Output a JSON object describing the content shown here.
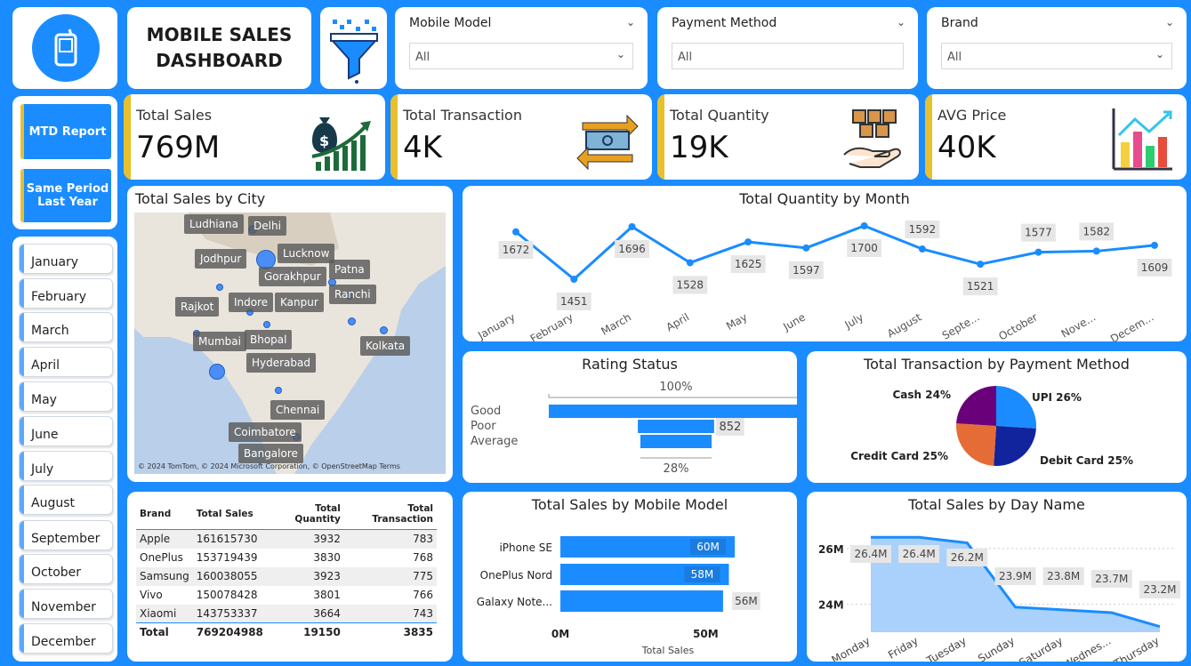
{
  "header": {
    "title_line1": "MOBILE SALES",
    "title_line2": "DASHBOARD"
  },
  "icons": {
    "logo": "mobile-phone-icon",
    "filter": "funnel-filter-icon"
  },
  "slicers": [
    {
      "label": "Mobile Model",
      "value": "All"
    },
    {
      "label": "Payment Method",
      "value": "All"
    },
    {
      "label": "Brand",
      "value": "All"
    }
  ],
  "kpis": [
    {
      "label": "Total Sales",
      "value": "769M",
      "icon": "money-growth-icon"
    },
    {
      "label": "Total Transaction",
      "value": "4K",
      "icon": "cash-exchange-icon"
    },
    {
      "label": "Total Quantity",
      "value": "19K",
      "icon": "boxes-hand-icon"
    },
    {
      "label": "AVG Price",
      "value": "40K",
      "icon": "bar-chart-icon"
    }
  ],
  "nav": {
    "mtd_label": "MTD Report",
    "same_period_line1": "Same Period",
    "same_period_line2": "Last Year"
  },
  "months": [
    "January",
    "February",
    "March",
    "April",
    "May",
    "June",
    "July",
    "August",
    "September",
    "October",
    "November",
    "December"
  ],
  "map": {
    "title": "Total Sales by City",
    "cities": [
      "Ludhiana",
      "Delhi",
      "Lucknow",
      "Jodhpur",
      "Patna",
      "Gorakhpur",
      "Ranchi",
      "Rajkot",
      "Indore",
      "Kanpur",
      "Bhopal",
      "Mumbai",
      "Kolkata",
      "Hyderabad",
      "Chennai",
      "Coimbatore",
      "Bangalore"
    ],
    "attribution": "© 2024 TomTom, © 2024 Microsoft Corporation, © OpenStreetMap  Terms"
  },
  "colors": {
    "background": "#1a8cff",
    "accent": "#1a8cff",
    "kpi_bar": "#e8c02e",
    "pie_upi": "#1a8cff",
    "pie_debit": "#12239e",
    "pie_credit": "#e66c37",
    "pie_cash": "#6b007b"
  },
  "table": {
    "headers": [
      "Brand",
      "Total Sales",
      "Total Quantity",
      "Total Transaction"
    ],
    "rows": [
      [
        "Apple",
        "161615730",
        "3932",
        "783"
      ],
      [
        "OnePlus",
        "153719439",
        "3830",
        "768"
      ],
      [
        "Samsung",
        "160038055",
        "3923",
        "775"
      ],
      [
        "Vivo",
        "150078428",
        "3801",
        "766"
      ],
      [
        "Xiaomi",
        "143753337",
        "3664",
        "743"
      ]
    ],
    "total": [
      "Total",
      "769204988",
      "19150",
      "3835"
    ]
  },
  "chart_data": [
    {
      "type": "line",
      "title": "Total Quantity by Month",
      "categories": [
        "January",
        "February",
        "March",
        "April",
        "May",
        "June",
        "July",
        "August",
        "Septe...",
        "October",
        "Nove...",
        "Decem..."
      ],
      "values": [
        1672,
        1451,
        1696,
        1528,
        1625,
        1597,
        1700,
        1592,
        1521,
        1577,
        1582,
        1609
      ],
      "value_labels": [
        "1672",
        "1451",
        "1696",
        "1528",
        "1625",
        "1597",
        "1700",
        "1592",
        "1521",
        "1577",
        "1582",
        "1609"
      ]
    },
    {
      "type": "bar",
      "title": "Rating Status",
      "categories": [
        "Good",
        "Poor",
        "Average"
      ],
      "values": [
        1.0,
        0.3,
        0.28
      ],
      "top_label": "100%",
      "bottom_label": "28%",
      "value_label": "852"
    },
    {
      "type": "pie",
      "title": "Total Transaction by Payment Method",
      "categories": [
        "UPI",
        "Debit Card",
        "Credit Card",
        "Cash"
      ],
      "values": [
        26,
        25,
        25,
        24
      ],
      "labels": [
        "UPI 26%",
        "Debit Card 25%",
        "Credit Card 25%",
        "Cash 24%"
      ]
    },
    {
      "type": "bar",
      "title": "Total Sales by Mobile Model",
      "categories": [
        "iPhone SE",
        "OnePlus Nord",
        "Galaxy Note..."
      ],
      "values": [
        60,
        58,
        56
      ],
      "value_labels": [
        "60M",
        "58M",
        "56M"
      ],
      "xlabel": "Total Sales",
      "ticks": [
        "0M",
        "50M"
      ],
      "xlim": [
        0,
        68
      ]
    },
    {
      "type": "area",
      "title": "Total Sales by Day Name",
      "categories": [
        "Monday",
        "Friday",
        "Tuesday",
        "Sunday",
        "Saturday",
        "Wednes...",
        "Thursday"
      ],
      "values": [
        26.4,
        26.4,
        26.2,
        23.9,
        23.8,
        23.7,
        23.2
      ],
      "value_labels": [
        "26.4M",
        "26.4M",
        "26.2M",
        "23.9M",
        "23.8M",
        "23.7M",
        "23.2M"
      ],
      "yticks": [
        "26M",
        "24M"
      ],
      "ylim": [
        23,
        26.6
      ]
    }
  ]
}
